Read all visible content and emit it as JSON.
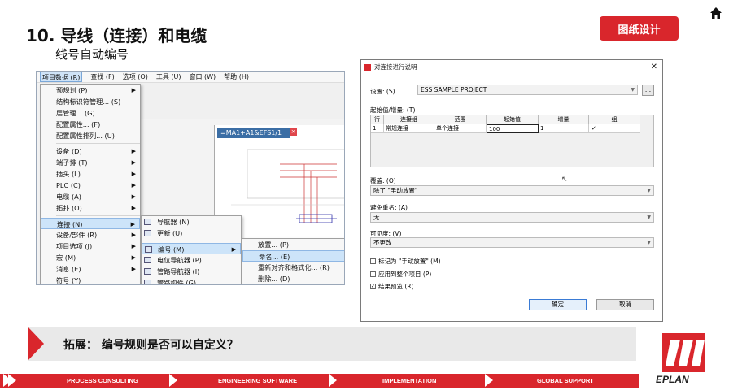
{
  "header": {
    "title": "10. 导线（连接）和电缆",
    "subtitle": "线号自动编号",
    "badge": "图纸设计",
    "colors": {
      "accent": "#d9262c"
    }
  },
  "eplan_window": {
    "menubar": [
      "项目数据 (R)",
      "查找 (F)",
      "选项 (O)",
      "工具 (U)",
      "窗口 (W)",
      "帮助 (H)"
    ],
    "drawing_tab": "=MA1+A1&EFS1/1",
    "main_menu": [
      {
        "label": "预规划 (P)",
        "arrow": true
      },
      {
        "label": "结构标识符管理... (S)",
        "arrow": false
      },
      {
        "label": "层管理... (G)",
        "arrow": false
      },
      {
        "label": "配置属性... (F)",
        "arrow": false
      },
      {
        "label": "配置属性排列... (U)",
        "arrow": false
      },
      {
        "label": "设备 (D)",
        "arrow": true
      },
      {
        "label": "端子排 (T)",
        "arrow": true
      },
      {
        "label": "插头 (L)",
        "arrow": true
      },
      {
        "label": "PLC (C)",
        "arrow": true
      },
      {
        "label": "电缆 (A)",
        "arrow": true
      },
      {
        "label": "拓扑 (O)",
        "arrow": true
      },
      {
        "label": "连接 (N)",
        "arrow": true,
        "highlight": true
      },
      {
        "label": "设备/部件 (R)",
        "arrow": true
      },
      {
        "label": "项目选项 (J)",
        "arrow": true
      },
      {
        "label": "宏 (M)",
        "arrow": true
      },
      {
        "label": "消息 (E)",
        "arrow": true
      },
      {
        "label": "符号 (Y)",
        "arrow": false
      }
    ],
    "sub_menu": [
      {
        "label": "导航器 (N)",
        "arrow": false
      },
      {
        "label": "更新 (U)",
        "arrow": false
      },
      {
        "label": "编号 (M)",
        "arrow": true,
        "highlight": true
      },
      {
        "label": "电位导航器 (P)",
        "arrow": false
      },
      {
        "label": "管路导航器 (I)",
        "arrow": false
      },
      {
        "label": "管路构件 (G)",
        "arrow": false
      }
    ],
    "sub_sub_menu": [
      {
        "label": "放置... (P)",
        "highlight": false
      },
      {
        "label": "命名... (E)",
        "highlight": true
      },
      {
        "label": "重新对齐和格式化... (R)",
        "highlight": false
      },
      {
        "label": "删除... (D)",
        "highlight": false
      }
    ]
  },
  "dialog": {
    "title": "对连接进行说明",
    "close": "✕",
    "settings_label": "设置: (S)",
    "settings_value": "ESS SAMPLE PROJECT",
    "settings_btn": "...",
    "start_label": "起始值/增量: (T)",
    "table_headers": [
      "行",
      "连接组",
      "范围",
      "起始值",
      "增量",
      "组"
    ],
    "table_row": [
      "1",
      "常规连接",
      "单个连接",
      "100",
      "1",
      "✓"
    ],
    "overwrite_label": "覆盖: (O)",
    "overwrite_value": "除了 \"手动放置\"",
    "avoid_label": "避免重名: (A)",
    "avoid_value": "无",
    "visible_label": "可见度: (V)",
    "visible_value": "不更改",
    "chk1": "标记为 \"手动放置\" (M)",
    "chk2": "应用到整个项目 (P)",
    "chk3": "结果预览 (R)",
    "ok": "确定",
    "cancel": "取消"
  },
  "banner": {
    "text": "拓展：  编号规则是否可以自定义？"
  },
  "footer": {
    "items": [
      "PROCESS CONSULTING",
      "ENGINEERING SOFTWARE",
      "IMPLEMENTATION",
      "GLOBAL SUPPORT"
    ],
    "logo": "EPLAN"
  }
}
